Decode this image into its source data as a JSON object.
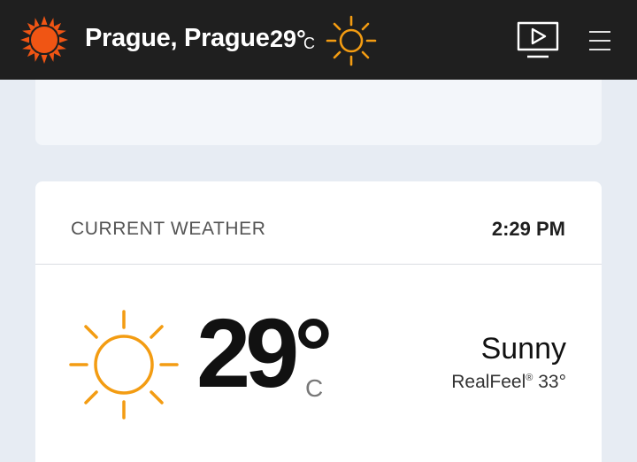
{
  "header": {
    "location": "Prague, Prague",
    "temperature": "29°",
    "unit": "C",
    "logo_icon": "sun-logo-icon",
    "condition_icon": "sun-icon",
    "video_icon": "video-play-icon",
    "menu_icon": "hamburger-menu-icon"
  },
  "current": {
    "label": "CURRENT WEATHER",
    "time": "2:29 PM",
    "temperature": "29°",
    "unit": "C",
    "phrase": "Sunny",
    "realfeel_label": "RealFeel",
    "realfeel_mark": "®",
    "realfeel_value": "33°",
    "icon": "sun-icon"
  },
  "colors": {
    "header_bg": "#1f1f1f",
    "accent": "#f05514",
    "sun": "#f39c12",
    "page_bg": "#e7ecf3"
  }
}
